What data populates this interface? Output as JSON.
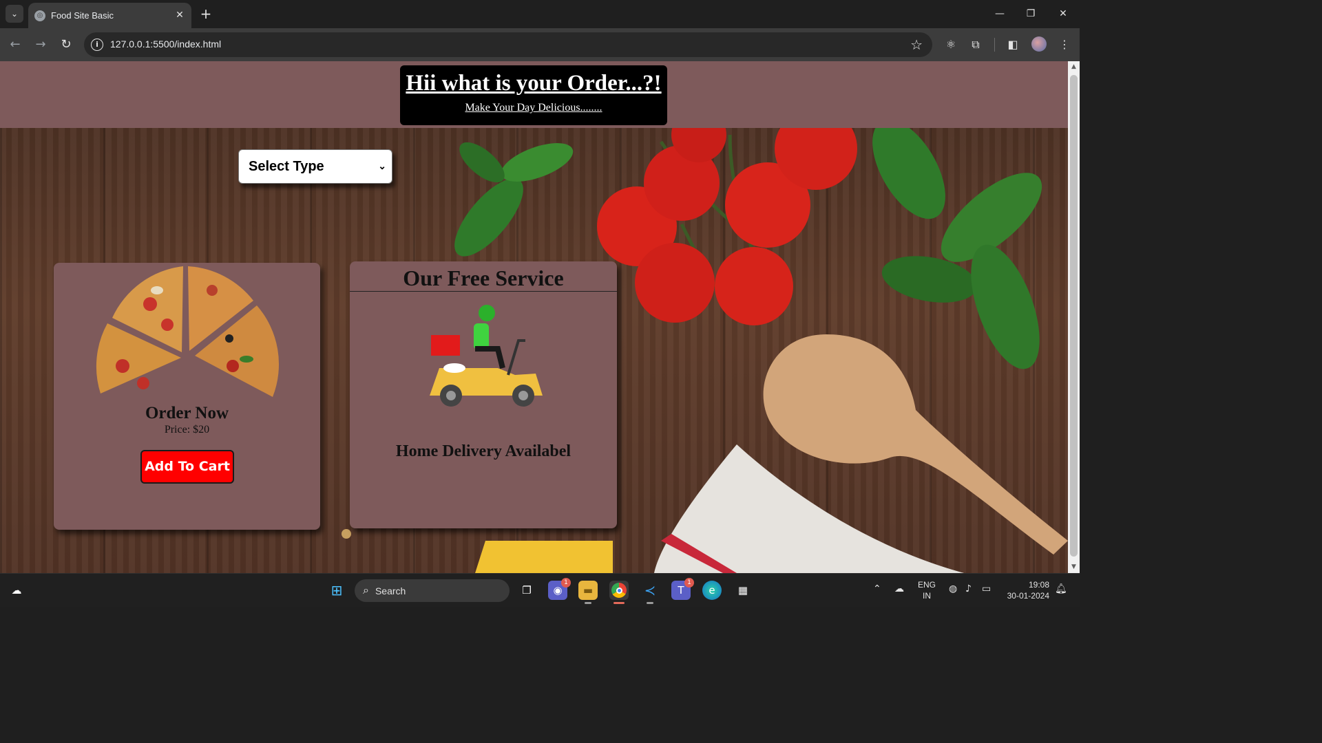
{
  "browser": {
    "tab_title": "Food Site Basic",
    "url": "127.0.0.1:5500/index.html",
    "tab_close": "✕",
    "new_tab": "+",
    "window_controls": {
      "minimize": "—",
      "restore": "❐",
      "close": "✕"
    },
    "nav": {
      "back": "←",
      "forward": "→",
      "reload": "↻"
    }
  },
  "header": {
    "title": "Hii what is your Order...?!",
    "subtitle": "Make Your Day Delicious........"
  },
  "select": {
    "selected": "Select Type",
    "chevron": "⌄"
  },
  "order_card": {
    "title": "Order Now",
    "price": "Price: $20",
    "button": "Add To Cart",
    "image_icon": "pizza-icon"
  },
  "service_card": {
    "title": "Our Free Service",
    "subtitle": "Home Delivery Availabel",
    "image_icon": "delivery-scooter-icon"
  },
  "taskbar": {
    "search_label": "Search",
    "language_line1": "ENG",
    "language_line2": "IN",
    "time": "19:08",
    "date": "30-01-2024",
    "badge_chat": "1",
    "badge_teams": "1"
  },
  "colors": {
    "header_bg": "#7e5a5b",
    "card_bg": "#7e5a5b",
    "cart_button": "#ff0000",
    "hero_bg": "#000000"
  }
}
